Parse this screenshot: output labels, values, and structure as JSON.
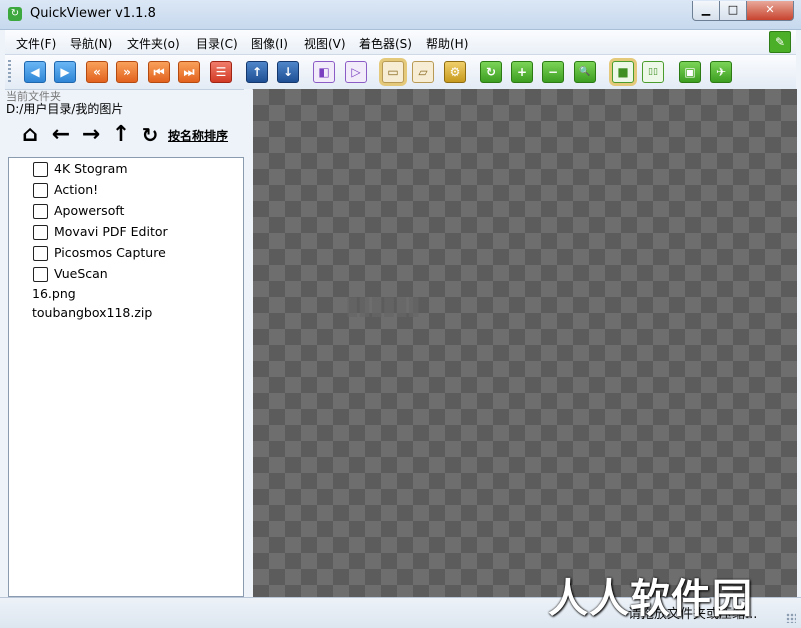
{
  "window": {
    "title": "QuickViewer v1.1.8"
  },
  "menu": [
    "文件(F)",
    "导航(N)",
    "文件夹(o)",
    "目录(C)",
    "图像(I)",
    "视图(V)",
    "着色器(S)",
    "帮助(H)"
  ],
  "toolbar": {
    "buttons": [
      {
        "name": "prev-page-icon",
        "glyph": "◀",
        "color": "blue"
      },
      {
        "name": "next-page-icon",
        "glyph": "▶",
        "color": "blue"
      },
      {
        "name": "rewind-icon",
        "glyph": "«",
        "color": "orange"
      },
      {
        "name": "fast-forward-icon",
        "glyph": "»",
        "color": "orange"
      },
      {
        "name": "first-page-icon",
        "glyph": "⏮",
        "color": "orange"
      },
      {
        "name": "last-page-icon",
        "glyph": "⏭",
        "color": "orange"
      },
      {
        "name": "list-icon",
        "glyph": "☰",
        "color": "red"
      },
      {
        "name": "prev-volume-icon",
        "glyph": "↑",
        "color": "navy"
      },
      {
        "name": "next-volume-icon",
        "glyph": "↓",
        "color": "navy"
      },
      {
        "name": "prev-frame-icon",
        "glyph": "◧",
        "color": "purple"
      },
      {
        "name": "next-frame-icon",
        "glyph": "▷",
        "color": "purple"
      },
      {
        "name": "folder-icon",
        "glyph": "▭",
        "color": "tan",
        "active": true
      },
      {
        "name": "catalog-icon",
        "glyph": "▱",
        "color": "tan"
      },
      {
        "name": "gear-icon",
        "glyph": "⚙",
        "color": "gold"
      },
      {
        "name": "rotate-icon",
        "glyph": "↻",
        "color": "green"
      },
      {
        "name": "zoom-in-icon",
        "glyph": "+",
        "color": "green"
      },
      {
        "name": "zoom-out-icon",
        "glyph": "−",
        "color": "green"
      },
      {
        "name": "magnifier-icon",
        "glyph": "🔍",
        "color": "green"
      },
      {
        "name": "single-page-icon",
        "glyph": "■",
        "color": "lightgreen",
        "active": true
      },
      {
        "name": "dual-page-icon",
        "glyph": "▯▯",
        "color": "lightgreen"
      },
      {
        "name": "slideshow-icon",
        "glyph": "▣",
        "color": "green"
      },
      {
        "name": "pin-icon",
        "glyph": "✈",
        "color": "green"
      }
    ]
  },
  "left_panel": {
    "caption": "当前文件夹",
    "path": "D:/用户目录/我的图片",
    "sort_label": "按名称排序",
    "nav_icons": [
      {
        "name": "home-icon",
        "glyph": "⌂"
      },
      {
        "name": "arrow-left-icon",
        "glyph": "←"
      },
      {
        "name": "arrow-right-icon",
        "glyph": "→"
      },
      {
        "name": "arrow-up-icon",
        "glyph": "↑"
      },
      {
        "name": "refresh-icon",
        "glyph": "↻"
      }
    ],
    "items": [
      {
        "type": "folder",
        "label": "4K Stogram"
      },
      {
        "type": "folder",
        "label": "Action!"
      },
      {
        "type": "folder",
        "label": "Apowersoft"
      },
      {
        "type": "folder",
        "label": "Movavi PDF Editor"
      },
      {
        "type": "folder",
        "label": "Picosmos Capture"
      },
      {
        "type": "folder",
        "label": "VueScan"
      },
      {
        "type": "file",
        "label": "16.png"
      },
      {
        "type": "file",
        "label": "toubangbox118.zip"
      }
    ]
  },
  "status": {
    "text": "请拖放文件夹或压缩..."
  },
  "watermark": {
    "text": "人人软件园"
  }
}
